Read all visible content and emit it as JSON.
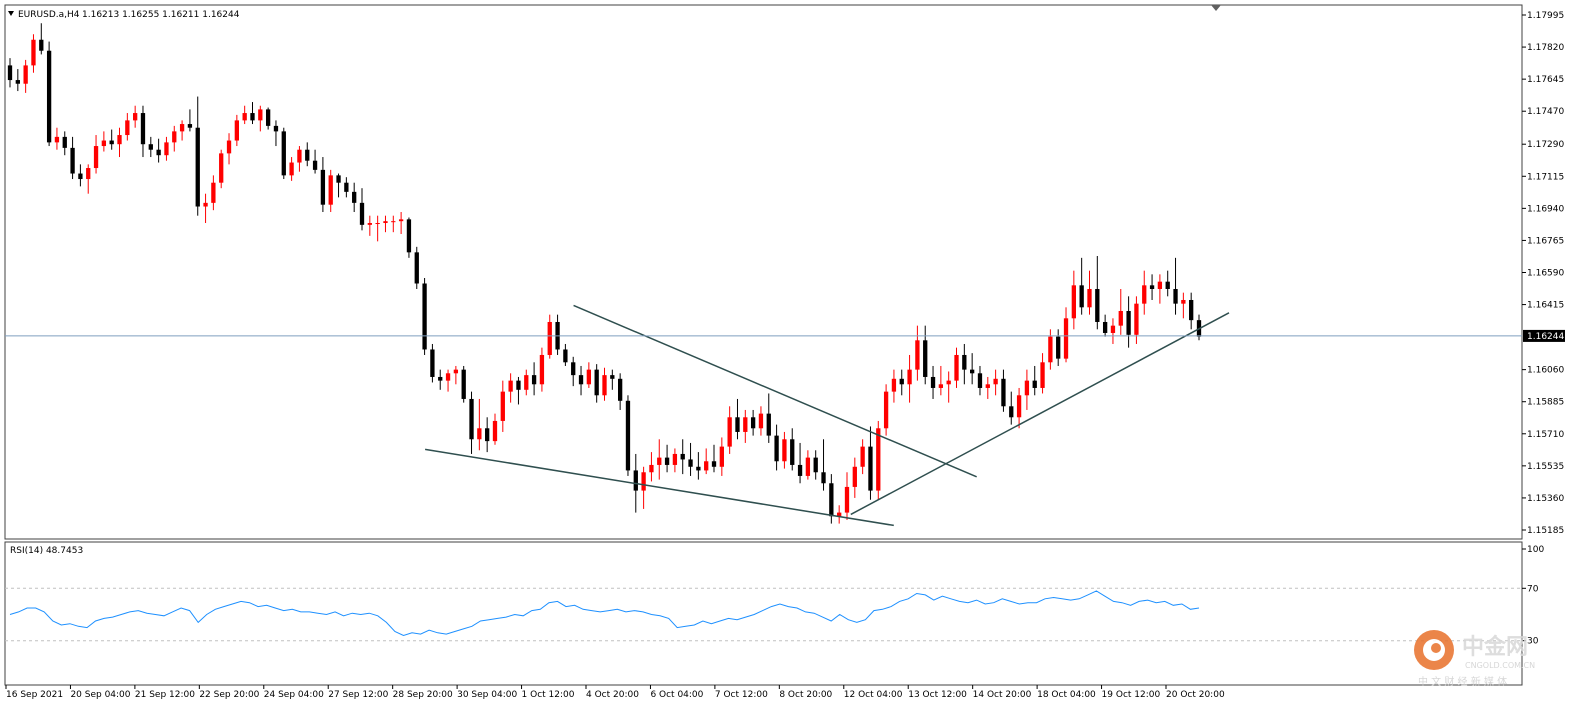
{
  "header": {
    "symbol_label": "EURUSD.a,H4",
    "ohlc_label": "1.16213 1.16255 1.16211 1.16244"
  },
  "rsi_header": {
    "label": "RSI(14) 48.7453"
  },
  "watermark": {
    "brand": "中金网",
    "domain": "CNGOLD.COM.CN",
    "tagline": "中 文 财 经 新 媒 体",
    "accent": "#e8702a"
  },
  "colors": {
    "bull": "#ff0000",
    "bear": "#000000",
    "trend": "#2f4f4f",
    "price_line": "#7f9fbf",
    "rsi_line": "#1e90ff",
    "grid": "#c0c0c0"
  },
  "chart_data": [
    {
      "type": "candlestick",
      "symbol": "EURUSD.a",
      "timeframe": "H4",
      "ylim": [
        1.15185,
        1.17995
      ],
      "y_ticks": [
        "1.17995",
        "1.17820",
        "1.17645",
        "1.17470",
        "1.17290",
        "1.17115",
        "1.16940",
        "1.16765",
        "1.16590",
        "1.16415",
        "1.16244",
        "1.16060",
        "1.15885",
        "1.15710",
        "1.15535",
        "1.15360",
        "1.15185"
      ],
      "current_price": "1.16244",
      "x_ticks": [
        "16 Sep 2021",
        "20 Sep 04:00",
        "21 Sep 12:00",
        "22 Sep 20:00",
        "24 Sep 04:00",
        "27 Sep 12:00",
        "28 Sep 20:00",
        "30 Sep 04:00",
        "1 Oct 12:00",
        "4 Oct 20:00",
        "6 Oct 04:00",
        "7 Oct 12:00",
        "8 Oct 20:00",
        "12 Oct 04:00",
        "13 Oct 12:00",
        "14 Oct 20:00",
        "18 Oct 04:00",
        "19 Oct 12:00",
        "20 Oct 20:00"
      ],
      "candles": [
        [
          1.1772,
          1.1776,
          1.176,
          1.1764
        ],
        [
          1.1764,
          1.177,
          1.1758,
          1.1762
        ],
        [
          1.1762,
          1.1775,
          1.1757,
          1.1772
        ],
        [
          1.1772,
          1.1789,
          1.1768,
          1.1786
        ],
        [
          1.1786,
          1.1795,
          1.1778,
          1.178
        ],
        [
          1.178,
          1.1785,
          1.1728,
          1.173
        ],
        [
          1.173,
          1.1738,
          1.1726,
          1.1733
        ],
        [
          1.1733,
          1.1736,
          1.1723,
          1.1727
        ],
        [
          1.1727,
          1.1733,
          1.171,
          1.1713
        ],
        [
          1.1713,
          1.1718,
          1.1706,
          1.171
        ],
        [
          1.171,
          1.1718,
          1.1702,
          1.1716
        ],
        [
          1.1716,
          1.1734,
          1.1713,
          1.1728
        ],
        [
          1.1728,
          1.1736,
          1.1725,
          1.1731
        ],
        [
          1.1731,
          1.1737,
          1.1726,
          1.1729
        ],
        [
          1.1729,
          1.1738,
          1.1722,
          1.1734
        ],
        [
          1.1734,
          1.1746,
          1.1731,
          1.1742
        ],
        [
          1.1742,
          1.175,
          1.1738,
          1.1746
        ],
        [
          1.1746,
          1.175,
          1.1722,
          1.1729
        ],
        [
          1.1729,
          1.1733,
          1.1722,
          1.1726
        ],
        [
          1.1726,
          1.1732,
          1.1719,
          1.1723
        ],
        [
          1.1723,
          1.1733,
          1.172,
          1.173
        ],
        [
          1.173,
          1.1739,
          1.1725,
          1.1736
        ],
        [
          1.1736,
          1.1742,
          1.1731,
          1.174
        ],
        [
          1.174,
          1.1748,
          1.1736,
          1.1738
        ],
        [
          1.1738,
          1.1755,
          1.169,
          1.1695
        ],
        [
          1.1695,
          1.1702,
          1.1686,
          1.1697
        ],
        [
          1.1697,
          1.1712,
          1.1693,
          1.1708
        ],
        [
          1.1708,
          1.1726,
          1.1705,
          1.1724
        ],
        [
          1.1724,
          1.1735,
          1.1718,
          1.1731
        ],
        [
          1.1731,
          1.1745,
          1.1728,
          1.1742
        ],
        [
          1.1742,
          1.175,
          1.174,
          1.1746
        ],
        [
          1.1746,
          1.1752,
          1.174,
          1.1742
        ],
        [
          1.1742,
          1.175,
          1.1736,
          1.1748
        ],
        [
          1.1748,
          1.1749,
          1.1737,
          1.1739
        ],
        [
          1.1739,
          1.1742,
          1.1728,
          1.1736
        ],
        [
          1.1736,
          1.1738,
          1.171,
          1.1712
        ],
        [
          1.1712,
          1.1722,
          1.1709,
          1.1719
        ],
        [
          1.1719,
          1.1728,
          1.1714,
          1.1726
        ],
        [
          1.1726,
          1.173,
          1.1717,
          1.172
        ],
        [
          1.172,
          1.1726,
          1.1713,
          1.1715
        ],
        [
          1.1715,
          1.1722,
          1.1692,
          1.1696
        ],
        [
          1.1696,
          1.1715,
          1.1692,
          1.1712
        ],
        [
          1.1712,
          1.1713,
          1.17,
          1.1708
        ],
        [
          1.1708,
          1.1711,
          1.17,
          1.1703
        ],
        [
          1.1703,
          1.1708,
          1.1692,
          1.1697
        ],
        [
          1.1697,
          1.1705,
          1.1682,
          1.1685
        ],
        [
          1.1685,
          1.169,
          1.1679,
          1.1686
        ],
        [
          1.1686,
          1.169,
          1.1676,
          1.1686
        ],
        [
          1.1686,
          1.169,
          1.1681,
          1.1687
        ],
        [
          1.1687,
          1.169,
          1.1681,
          1.1687
        ],
        [
          1.1687,
          1.1692,
          1.168,
          1.1688
        ],
        [
          1.1688,
          1.1689,
          1.1667,
          1.167
        ],
        [
          1.167,
          1.1673,
          1.165,
          1.1653
        ],
        [
          1.1653,
          1.1656,
          1.1614,
          1.1617
        ],
        [
          1.1617,
          1.162,
          1.1599,
          1.1602
        ],
        [
          1.1602,
          1.1606,
          1.1595,
          1.16
        ],
        [
          1.16,
          1.1606,
          1.1594,
          1.1604
        ],
        [
          1.1604,
          1.1608,
          1.1598,
          1.1606
        ],
        [
          1.1606,
          1.1608,
          1.1588,
          1.159
        ],
        [
          1.159,
          1.1594,
          1.156,
          1.1568
        ],
        [
          1.1568,
          1.159,
          1.1562,
          1.1574
        ],
        [
          1.1574,
          1.158,
          1.1561,
          1.1567
        ],
        [
          1.1567,
          1.1582,
          1.1565,
          1.1578
        ],
        [
          1.1578,
          1.16,
          1.1572,
          1.1594
        ],
        [
          1.1594,
          1.1604,
          1.1588,
          1.16
        ],
        [
          1.16,
          1.1602,
          1.1587,
          1.1595
        ],
        [
          1.1595,
          1.1606,
          1.1592,
          1.1603
        ],
        [
          1.1603,
          1.161,
          1.1592,
          1.1598
        ],
        [
          1.1598,
          1.1618,
          1.1594,
          1.1614
        ],
        [
          1.1614,
          1.1636,
          1.1612,
          1.1632
        ],
        [
          1.1632,
          1.1636,
          1.1614,
          1.1617
        ],
        [
          1.1617,
          1.162,
          1.1608,
          1.161
        ],
        [
          1.161,
          1.1613,
          1.1597,
          1.1603
        ],
        [
          1.1603,
          1.1608,
          1.1592,
          1.1598
        ],
        [
          1.1598,
          1.161,
          1.1596,
          1.1606
        ],
        [
          1.1606,
          1.1609,
          1.1588,
          1.1592
        ],
        [
          1.1592,
          1.1607,
          1.1589,
          1.1603
        ],
        [
          1.1603,
          1.1606,
          1.1595,
          1.1601
        ],
        [
          1.1601,
          1.1604,
          1.1584,
          1.1589
        ],
        [
          1.1589,
          1.1592,
          1.1548,
          1.1551
        ],
        [
          1.1551,
          1.156,
          1.1528,
          1.154
        ],
        [
          1.154,
          1.1553,
          1.153,
          1.155
        ],
        [
          1.155,
          1.1561,
          1.1545,
          1.1554
        ],
        [
          1.1554,
          1.1568,
          1.1546,
          1.1558
        ],
        [
          1.1558,
          1.1565,
          1.155,
          1.1554
        ],
        [
          1.1554,
          1.1563,
          1.155,
          1.156
        ],
        [
          1.156,
          1.1568,
          1.1549,
          1.1557
        ],
        [
          1.1557,
          1.1566,
          1.1548,
          1.1553
        ],
        [
          1.1553,
          1.1561,
          1.1546,
          1.1551
        ],
        [
          1.1551,
          1.1563,
          1.1549,
          1.1556
        ],
        [
          1.1556,
          1.1565,
          1.155,
          1.1553
        ],
        [
          1.1553,
          1.1569,
          1.1548,
          1.1564
        ],
        [
          1.1564,
          1.1586,
          1.156,
          1.158
        ],
        [
          1.158,
          1.159,
          1.1568,
          1.1572
        ],
        [
          1.1572,
          1.1584,
          1.1566,
          1.158
        ],
        [
          1.158,
          1.1584,
          1.157,
          1.1574
        ],
        [
          1.1574,
          1.1586,
          1.157,
          1.1582
        ],
        [
          1.1582,
          1.1593,
          1.1566,
          1.157
        ],
        [
          1.157,
          1.1576,
          1.1551,
          1.1556
        ],
        [
          1.1556,
          1.1572,
          1.1552,
          1.1568
        ],
        [
          1.1568,
          1.1574,
          1.1551,
          1.1554
        ],
        [
          1.1554,
          1.1566,
          1.1544,
          1.1548
        ],
        [
          1.1548,
          1.1562,
          1.1546,
          1.1558
        ],
        [
          1.1558,
          1.1562,
          1.1546,
          1.155
        ],
        [
          1.155,
          1.1568,
          1.154,
          1.1544
        ],
        [
          1.1544,
          1.1549,
          1.1522,
          1.1526
        ],
        [
          1.1526,
          1.1532,
          1.1522,
          1.1528
        ],
        [
          1.1528,
          1.155,
          1.1524,
          1.1542
        ],
        [
          1.1542,
          1.1558,
          1.1536,
          1.1553
        ],
        [
          1.1553,
          1.1568,
          1.1549,
          1.1564
        ],
        [
          1.1564,
          1.1575,
          1.1535,
          1.154
        ],
        [
          1.154,
          1.1578,
          1.1535,
          1.1574
        ],
        [
          1.1574,
          1.1598,
          1.157,
          1.1594
        ],
        [
          1.1594,
          1.1606,
          1.1588,
          1.1601
        ],
        [
          1.1601,
          1.1606,
          1.1592,
          1.1598
        ],
        [
          1.1598,
          1.1614,
          1.1588,
          1.1606
        ],
        [
          1.1606,
          1.163,
          1.16,
          1.1622
        ],
        [
          1.1622,
          1.163,
          1.1598,
          1.1602
        ],
        [
          1.1602,
          1.1608,
          1.159,
          1.1596
        ],
        [
          1.1596,
          1.1608,
          1.1592,
          1.1598
        ],
        [
          1.1598,
          1.1605,
          1.1588,
          1.16
        ],
        [
          1.16,
          1.1618,
          1.1596,
          1.1614
        ],
        [
          1.1614,
          1.162,
          1.1598,
          1.1606
        ],
        [
          1.1606,
          1.1615,
          1.1598,
          1.1604
        ],
        [
          1.1604,
          1.1608,
          1.1592,
          1.1596
        ],
        [
          1.1596,
          1.1602,
          1.159,
          1.1598
        ],
        [
          1.1598,
          1.1606,
          1.1592,
          1.1601
        ],
        [
          1.1601,
          1.1606,
          1.1583,
          1.1586
        ],
        [
          1.1586,
          1.1594,
          1.1576,
          1.158
        ],
        [
          1.158,
          1.1596,
          1.1574,
          1.1592
        ],
        [
          1.1592,
          1.1606,
          1.1584,
          1.16
        ],
        [
          1.16,
          1.1608,
          1.1592,
          1.1596
        ],
        [
          1.1596,
          1.1615,
          1.1593,
          1.161
        ],
        [
          1.161,
          1.1628,
          1.1606,
          1.1624
        ],
        [
          1.1624,
          1.1628,
          1.1608,
          1.1612
        ],
        [
          1.1612,
          1.164,
          1.161,
          1.1634
        ],
        [
          1.1634,
          1.166,
          1.1628,
          1.1652
        ],
        [
          1.1652,
          1.1667,
          1.1636,
          1.164
        ],
        [
          1.164,
          1.166,
          1.1636,
          1.165
        ],
        [
          1.165,
          1.1668,
          1.1628,
          1.1632
        ],
        [
          1.1632,
          1.1636,
          1.1624,
          1.1626
        ],
        [
          1.1626,
          1.1634,
          1.162,
          1.163
        ],
        [
          1.163,
          1.165,
          1.1625,
          1.1638
        ],
        [
          1.1638,
          1.1646,
          1.1618,
          1.1625
        ],
        [
          1.1625,
          1.1646,
          1.162,
          1.1642
        ],
        [
          1.1642,
          1.166,
          1.1636,
          1.1652
        ],
        [
          1.1652,
          1.1658,
          1.1644,
          1.165
        ],
        [
          1.165,
          1.1658,
          1.1642,
          1.1654
        ],
        [
          1.1654,
          1.166,
          1.1646,
          1.165
        ],
        [
          1.165,
          1.1667,
          1.1636,
          1.1642
        ],
        [
          1.1642,
          1.1648,
          1.1634,
          1.1644
        ],
        [
          1.1644,
          1.1648,
          1.1628,
          1.1633
        ],
        [
          1.1633,
          1.1636,
          1.1622,
          1.1624
        ]
      ],
      "trendlines": [
        {
          "from": [
            1.1641,
            "1 Oct 12:00"
          ],
          "to": [
            1.15475,
            "14 Oct 20:00"
          ]
        },
        {
          "from": [
            1.15625,
            "30 Sep 04:00"
          ],
          "to": [
            1.1521,
            "12 Oct 04:00"
          ]
        },
        {
          "from": [
            1.1527,
            "12 Oct 04:00"
          ],
          "to": [
            1.1637,
            "20 Oct 20:00"
          ]
        }
      ]
    },
    {
      "type": "line",
      "name": "RSI(14) 48.7453",
      "ylim": [
        0,
        100
      ],
      "y_ticks": [
        "100",
        "70",
        "30"
      ],
      "levels": [
        70,
        30
      ],
      "values": [
        50,
        52,
        55,
        55,
        52,
        45,
        42,
        43,
        41,
        40,
        45,
        47,
        48,
        50,
        52,
        53,
        51,
        50,
        49,
        52,
        55,
        53,
        44,
        50,
        54,
        56,
        58,
        60,
        59,
        56,
        57,
        55,
        53,
        54,
        52,
        52,
        51,
        50,
        52,
        49,
        51,
        50,
        51,
        49,
        44,
        37,
        34,
        36,
        35,
        38,
        36,
        35,
        37,
        39,
        41,
        45,
        46,
        47,
        48,
        50,
        49,
        53,
        54,
        59,
        60,
        56,
        57,
        54,
        53,
        52,
        53,
        54,
        52,
        53,
        52,
        50,
        49,
        47,
        40,
        41,
        42,
        45,
        43,
        45,
        47,
        46,
        48,
        50,
        53,
        56,
        58,
        56,
        55,
        52,
        51,
        48,
        45,
        50,
        46,
        44,
        46,
        53,
        54,
        56,
        60,
        62,
        66,
        65,
        61,
        64,
        62,
        60,
        59,
        61,
        58,
        59,
        62,
        60,
        58,
        59,
        59,
        62,
        63,
        62,
        61,
        62,
        65,
        68,
        64,
        60,
        59,
        57,
        60,
        61,
        59,
        60,
        57,
        58,
        54,
        55
      ]
    }
  ]
}
